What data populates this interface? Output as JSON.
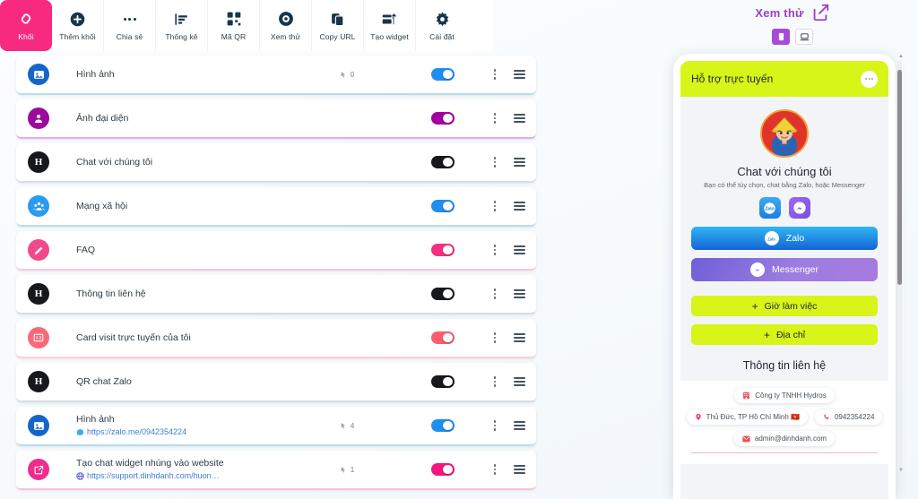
{
  "toolbar": {
    "items": [
      {
        "label": "Khối",
        "icon": "link-chain-icon",
        "active": true
      },
      {
        "label": "Thêm khối",
        "icon": "plus-circle-icon",
        "active": false
      },
      {
        "label": "Chia sẻ",
        "icon": "ellipsis-icon",
        "active": false
      },
      {
        "label": "Thống kê",
        "icon": "bar-chart-icon",
        "active": false
      },
      {
        "label": "Mã QR",
        "icon": "qr-code-icon",
        "active": false
      },
      {
        "label": "Xem thử",
        "icon": "eye-icon",
        "active": false
      },
      {
        "label": "Copy URL",
        "icon": "copy-icon",
        "active": false
      },
      {
        "label": "Tạo widget",
        "icon": "widget-icon",
        "active": false
      },
      {
        "label": "Cài đặt",
        "icon": "gear-icon",
        "active": false
      }
    ]
  },
  "blocks": [
    {
      "title": "Hình ảnh",
      "url": "",
      "url_icon": "",
      "count": "0",
      "badge_icon": "image-icon",
      "badge_color": "#1565c9",
      "toggle_color": "#1f8ef1",
      "toggle_on": true,
      "accent": "b-blue"
    },
    {
      "title": "Ảnh đại diện",
      "url": "",
      "url_icon": "",
      "count": "",
      "badge_icon": "person-icon",
      "badge_color": "#9c0a9c",
      "toggle_color": "#a1009f",
      "toggle_on": true,
      "accent": "b-purple"
    },
    {
      "title": "Chat với chúng tôi",
      "url": "",
      "url_icon": "",
      "count": "",
      "badge_icon": "letter-h-icon",
      "badge_color": "#17181c",
      "toggle_color": "#17181c",
      "toggle_on": true,
      "accent": "b-grey"
    },
    {
      "title": "Mạng xã hội",
      "url": "",
      "url_icon": "",
      "count": "",
      "badge_icon": "people-icon",
      "badge_color": "#2a9bf0",
      "toggle_color": "#1f8ef1",
      "toggle_on": true,
      "accent": "b-blue"
    },
    {
      "title": "FAQ",
      "url": "",
      "url_icon": "",
      "count": "",
      "badge_icon": "pencil-icon",
      "badge_color": "#f3498b",
      "toggle_color": "#f4307e",
      "toggle_on": true,
      "accent": "b-pink"
    },
    {
      "title": "Thông tin liên hệ",
      "url": "",
      "url_icon": "",
      "count": "",
      "badge_icon": "letter-h-icon",
      "badge_color": "#17181c",
      "toggle_color": "#17181c",
      "toggle_on": true,
      "accent": "b-grey"
    },
    {
      "title": "Card visit trực tuyến của tôi",
      "url": "",
      "url_icon": "",
      "count": "",
      "badge_icon": "card-icon",
      "badge_color": "#f86a78",
      "toggle_color": "#fb5d6d",
      "toggle_on": true,
      "accent": "b-red"
    },
    {
      "title": "QR chat Zalo",
      "url": "",
      "url_icon": "",
      "count": "",
      "badge_icon": "letter-h-icon",
      "badge_color": "#17181c",
      "toggle_color": "#17181c",
      "toggle_on": true,
      "accent": "b-grey"
    },
    {
      "title": "Hình ảnh",
      "url": "https://zalo.me/0942354224",
      "url_icon": "zalo-icon",
      "count": "4",
      "badge_icon": "image-icon",
      "badge_color": "#1565c9",
      "toggle_color": "#1f8ef1",
      "toggle_on": true,
      "accent": "b-blue"
    },
    {
      "title": "Tạo chat widget nhúng vào website",
      "url": "https://support.dinhdanh.com/huon…",
      "url_icon": "globe-icon",
      "count": "1",
      "badge_icon": "external-link-icon",
      "badge_color": "#ee2d8f",
      "toggle_color": "#f4177e",
      "toggle_on": true,
      "accent": "b-hot"
    }
  ],
  "preview": {
    "title": "Xem thử",
    "share_icon": "share-icon",
    "devices": [
      {
        "name": "mobile-view",
        "icon": "phone-icon",
        "selected": true
      },
      {
        "name": "desktop-view",
        "icon": "laptop-icon",
        "selected": false
      }
    ],
    "screen": {
      "header_title": "Hỗ trợ trực tuyến",
      "header_menu_icon": "more-icon",
      "avatar_icon": "avatar-farmer-icon",
      "chat_title": "Chat với chúng tôi",
      "chat_subtitle": "Bạn có thể tùy chọn, chat bằng Zalo, hoặc Messenger",
      "mini_icons": [
        {
          "name": "zalo-mini-icon",
          "label": "Zalo"
        },
        {
          "name": "messenger-mini-icon",
          "label": "Messenger"
        }
      ],
      "buttons": [
        {
          "label": "Zalo",
          "icon": "zalo-icon",
          "style": "zalo"
        },
        {
          "label": "Messenger",
          "icon": "messenger-icon",
          "style": "msgr"
        }
      ],
      "lime_buttons": [
        {
          "label": "Giờ làm việc",
          "icon": "plus-icon"
        },
        {
          "label": "Địa chỉ",
          "icon": "plus-icon"
        }
      ],
      "contact_title": "Thông tin liên hệ",
      "contacts": [
        [
          {
            "text": "Công ty TNHH Hydros",
            "icon": "building-icon"
          }
        ],
        [
          {
            "text": "Thủ Đức, TP Hồ Chí Minh 🇻🇳",
            "icon": "pin-icon"
          },
          {
            "text": "0942354224",
            "icon": "phone-call-icon"
          }
        ],
        [
          {
            "text": "admin@dinhdanh.com",
            "icon": "envelope-icon"
          }
        ]
      ]
    }
  },
  "colors": {
    "accent_pink": "#f72a7f",
    "lime": "#d7f518",
    "purple": "#9b3fc7"
  }
}
